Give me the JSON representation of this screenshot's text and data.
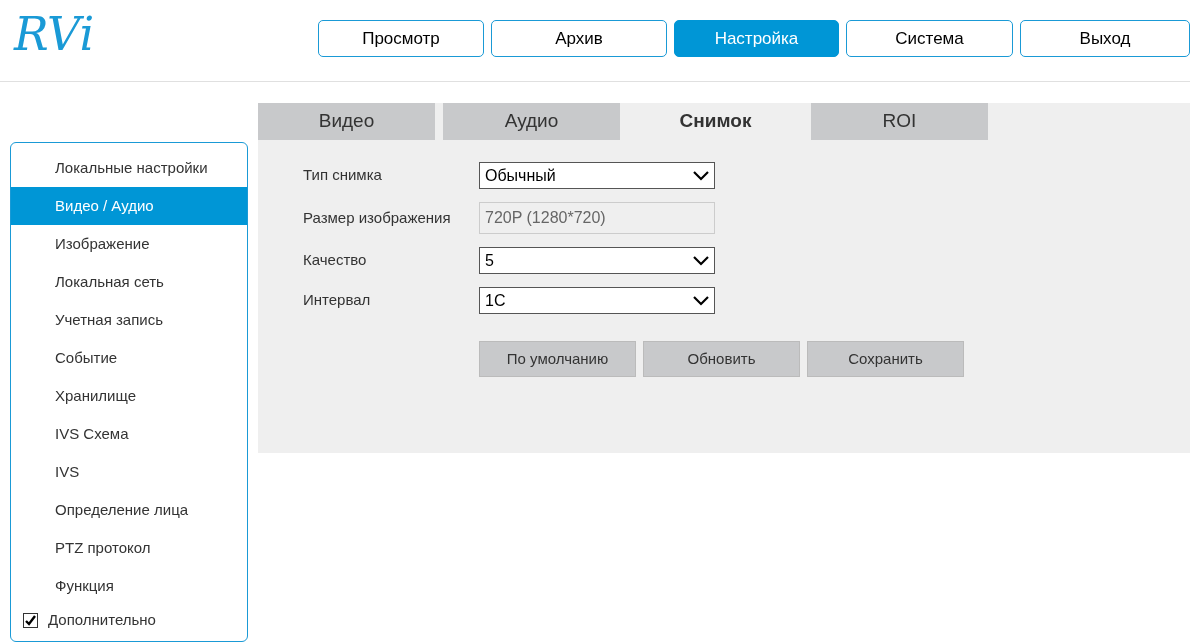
{
  "logo": "RVi",
  "nav": [
    {
      "label": "Просмотр",
      "selected": false
    },
    {
      "label": "Архив",
      "selected": false
    },
    {
      "label": "Настройка",
      "selected": true
    },
    {
      "label": "Система",
      "selected": false
    },
    {
      "label": "Выход",
      "selected": false
    }
  ],
  "sidebar": {
    "items": [
      {
        "label": "Локальные настройки",
        "selected": false
      },
      {
        "label": "Видео / Аудио",
        "selected": true
      },
      {
        "label": "Изображение",
        "selected": false
      },
      {
        "label": "Локальная сеть",
        "selected": false
      },
      {
        "label": "Учетная запись",
        "selected": false
      },
      {
        "label": "Событие",
        "selected": false
      },
      {
        "label": "Хранилище",
        "selected": false
      },
      {
        "label": "IVS Схема",
        "selected": false
      },
      {
        "label": "IVS",
        "selected": false
      },
      {
        "label": "Определение лица",
        "selected": false
      },
      {
        "label": "PTZ протокол",
        "selected": false
      },
      {
        "label": "Функция",
        "selected": false
      }
    ],
    "advanced": {
      "label": "Дополнительно",
      "checked": true
    }
  },
  "tabs": [
    {
      "label": "Видео",
      "selected": false
    },
    {
      "label": "Аудио",
      "selected": false
    },
    {
      "label": "Снимок",
      "selected": true
    },
    {
      "label": "ROI",
      "selected": false
    }
  ],
  "form": [
    {
      "label": "Тип снимка",
      "kind": "dropdown",
      "value": "Обычный"
    },
    {
      "label": "Размер изображения",
      "kind": "readonly",
      "value": "720P (1280*720)"
    },
    {
      "label": "Качество",
      "kind": "dropdown",
      "value": "5"
    },
    {
      "label": "Интервал",
      "kind": "dropdown",
      "value": "1С"
    }
  ],
  "buttons": [
    "По умолчанию",
    "Обновить",
    "Сохранить"
  ]
}
